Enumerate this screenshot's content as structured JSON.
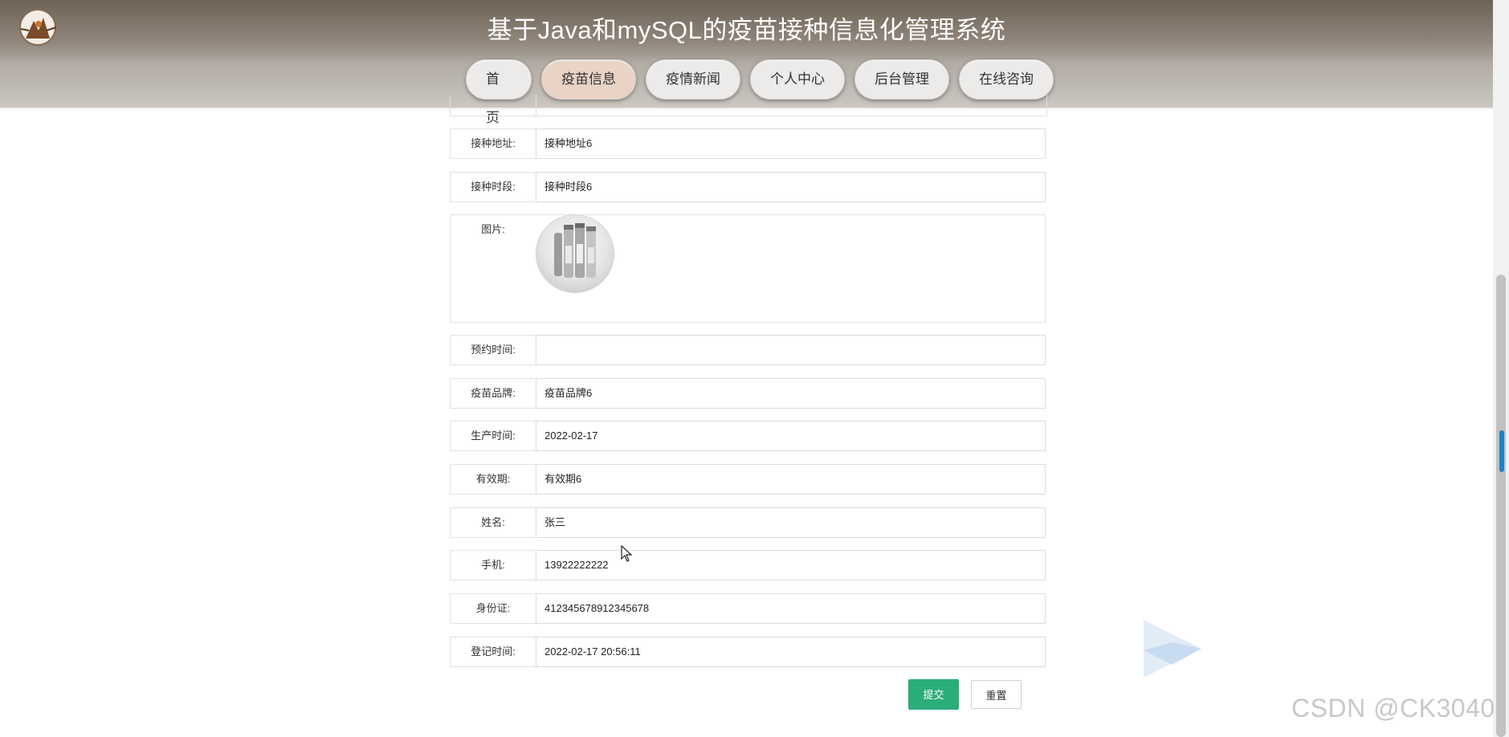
{
  "header": {
    "title": "基于Java和mySQL的疫苗接种信息化管理系统",
    "logo_icon": "vaccine-mascot-logo-icon"
  },
  "nav": {
    "items": [
      {
        "label": "首页",
        "active": false
      },
      {
        "label": "疫苗信息",
        "active": true
      },
      {
        "label": "疫情新闻",
        "active": false
      },
      {
        "label": "个人中心",
        "active": false
      },
      {
        "label": "后台管理",
        "active": false
      },
      {
        "label": "在线咨询",
        "active": false
      }
    ]
  },
  "form": {
    "address": {
      "label": "接种地址:",
      "value": "接种地址6"
    },
    "period": {
      "label": "接种时段:",
      "value": "接种时段6"
    },
    "image": {
      "label": "图片:"
    },
    "appointment": {
      "label": "预约时间:",
      "value": ""
    },
    "brand": {
      "label": "疫苗品牌:",
      "value": "疫苗品牌6"
    },
    "production": {
      "label": "生产时间:",
      "value": "2022-02-17"
    },
    "validity": {
      "label": "有效期:",
      "value": "有效期6"
    },
    "name": {
      "label": "姓名:",
      "value": "张三"
    },
    "phone": {
      "label": "手机:",
      "value": "13922222222"
    },
    "id_card": {
      "label": "身份证:",
      "value": "412345678912345678"
    },
    "register_time": {
      "label": "登记时间:",
      "value": "2022-02-17 20:56:11"
    }
  },
  "buttons": {
    "submit": "提交",
    "reset": "重置"
  },
  "watermark": "CSDN @CK3040",
  "colors": {
    "submit_bg": "#2bad79",
    "active_nav": "#e8d3c5",
    "scroll_marker": "#1e7fc8"
  }
}
